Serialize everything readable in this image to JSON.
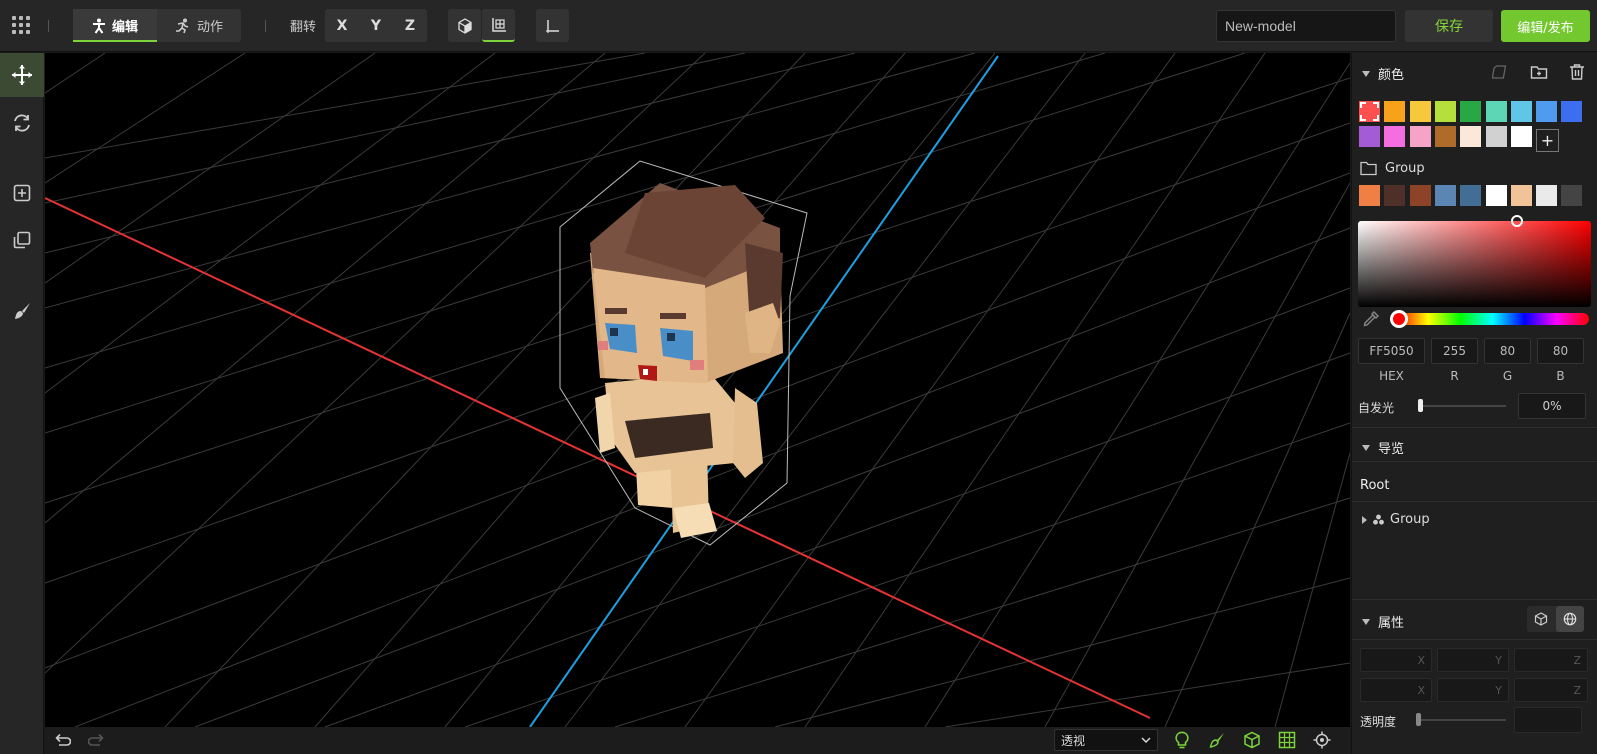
{
  "topbar": {
    "mode_edit": "编辑",
    "mode_anim": "动作",
    "flip_label": "翻转",
    "axis_x": "X",
    "axis_y": "Y",
    "axis_z": "Z",
    "model_name": "New-model",
    "save_label": "保存",
    "publish_label": "编辑/发布"
  },
  "colors_panel": {
    "title": "颜色",
    "palette_row1": [
      "#ff5050",
      "#f7a21a",
      "#f5c93b",
      "#b5e03b",
      "#28a745",
      "#5cd6b5",
      "#5fc6e8",
      "#4e9bf0",
      "#3d6ef0"
    ],
    "palette_row2": [
      "#a45cd6",
      "#f56ee0",
      "#f5a3c7",
      "#b06a2a",
      "#fbe8d8",
      "#d1d1d1",
      "#ffffff"
    ],
    "add_symbol": "+",
    "group_label": "Group",
    "group_row": [
      "#f07f45",
      "#4e3028",
      "#8c4328",
      "#5b86b3",
      "#426d94",
      "#ffffff",
      "#f2c299",
      "#eaeaea",
      "#444444"
    ],
    "hex": "FF5050",
    "r": "255",
    "g": "80",
    "b": "80",
    "hex_label": "HEX",
    "r_label": "R",
    "g_label": "G",
    "b_label": "B",
    "emissive_label": "自发光",
    "emissive_value": "0%",
    "emissive_level": 0
  },
  "nav_panel": {
    "title": "导览",
    "root_label": "Root",
    "group_label": "Group"
  },
  "props_panel": {
    "title": "属性",
    "axis_x": "X",
    "axis_y": "Y",
    "axis_z": "Z",
    "opacity_label": "透明度",
    "opacity_level": 0
  },
  "bottombar": {
    "view_mode": "透视"
  },
  "accent": "#7cd43a",
  "axis_colors": {
    "x": "#e53333",
    "z": "#1e9fe0"
  }
}
